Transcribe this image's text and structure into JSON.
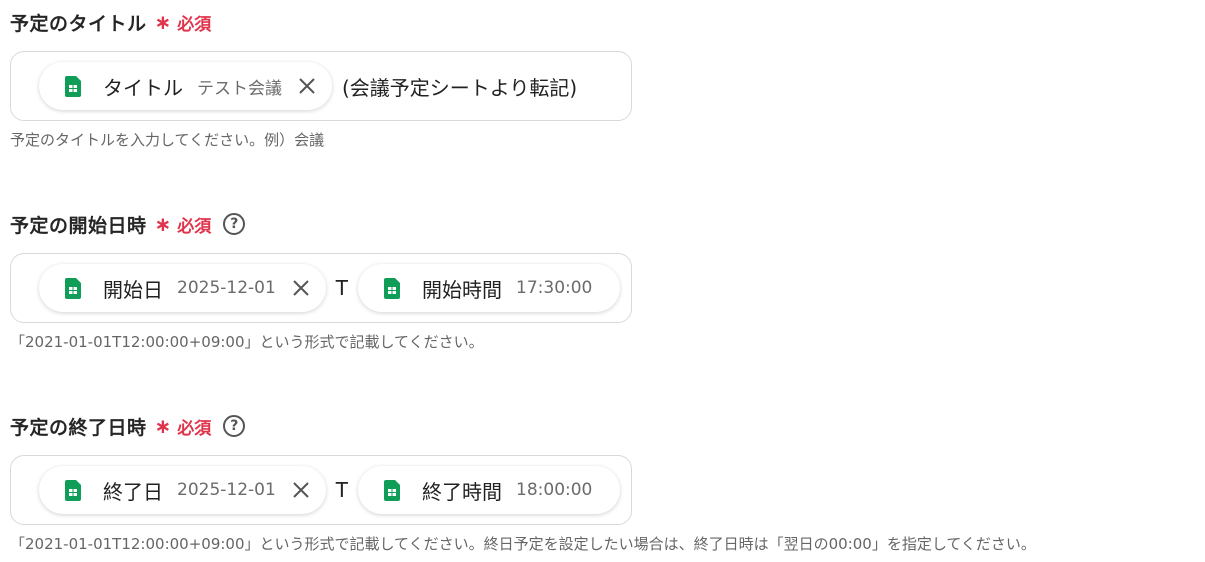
{
  "title_field": {
    "label": "予定のタイトル",
    "asterisk": "∗",
    "required": "必須",
    "chip_label": "タイトル",
    "chip_value": "テスト会議",
    "suffix_text": "(会議予定シートより転記)",
    "help": "予定のタイトルを入力してください。例）会議"
  },
  "start_field": {
    "label": "予定の開始日時",
    "asterisk": "∗",
    "required": "必須",
    "help_icon": "?",
    "chip1_label": "開始日",
    "chip1_value": "2025-12-01",
    "separator": "T",
    "chip2_label": "開始時間",
    "chip2_value": "17:30:00",
    "help": "「2021-01-01T12:00:00+09:00」という形式で記載してください。"
  },
  "end_field": {
    "label": "予定の終了日時",
    "asterisk": "∗",
    "required": "必須",
    "help_icon": "?",
    "chip1_label": "終了日",
    "chip1_value": "2025-12-01",
    "separator": "T",
    "chip2_label": "終了時間",
    "chip2_value": "18:00:00",
    "help": "「2021-01-01T12:00:00+09:00」という形式で記載してください。終日予定を設定したい場合は、終了日時は「翌日の00:00」を指定してください。"
  },
  "icons": {
    "sheet": "google-sheets-icon",
    "close": "close-icon",
    "help": "help-circle-icon"
  },
  "colors": {
    "required": "#e0344c",
    "sheet_green": "#0f9d58"
  }
}
